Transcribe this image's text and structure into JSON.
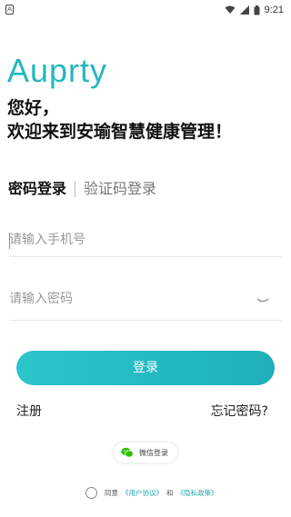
{
  "status_bar": {
    "left_icon_letter": "A",
    "time": "9:21"
  },
  "brand": {
    "logo": "Auprty",
    "accent_color": "#22b8bf"
  },
  "greeting": {
    "line1": "您好，",
    "line2": "欢迎来到安瑜智慧健康管理！"
  },
  "tabs": [
    {
      "label": "密码登录",
      "active": true
    },
    {
      "label": "验证码登录",
      "active": false
    }
  ],
  "phone_input": {
    "placeholder": "请输入手机号",
    "value": ""
  },
  "password_input": {
    "placeholder": "请输入密码",
    "value": ""
  },
  "login_button": {
    "label": "登录"
  },
  "links": {
    "register": "注册",
    "forgot": "忘记密码?"
  },
  "wechat": {
    "label": "微信登录",
    "icon": "wechat-icon"
  },
  "agreement": {
    "prefix": "同意",
    "user_agreement": "《用户协议》",
    "and": "和",
    "privacy_policy": "《隐私政策》"
  }
}
